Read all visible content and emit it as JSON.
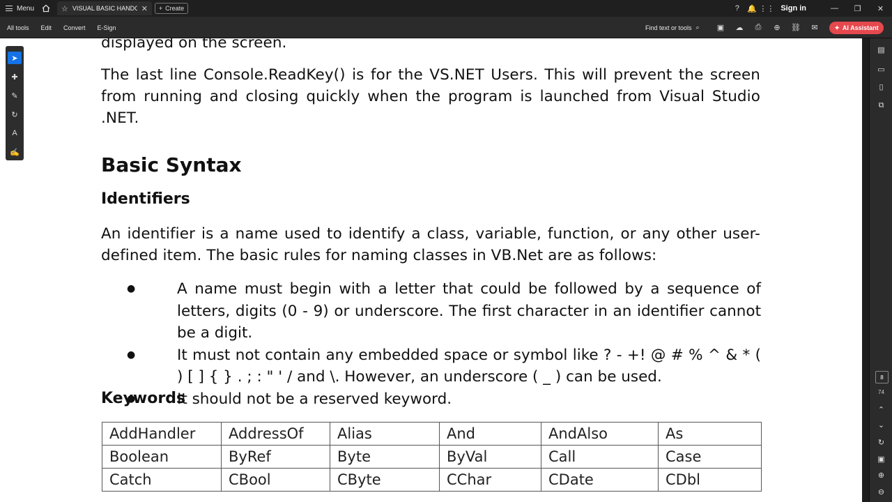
{
  "titlebar": {
    "menu_label": "Menu",
    "tab_title": "VISUAL BASIC HANDOU...",
    "create_label": "Create",
    "signin_label": "Sign in"
  },
  "toolbar": {
    "tools": [
      "All tools",
      "Edit",
      "Convert",
      "E-Sign"
    ],
    "find_label": "Find text or tools",
    "ai_label": "AI Assistant"
  },
  "document": {
    "line_top": "displayed on the screen.",
    "para1": "The last line Console.ReadKey() is for the VS.NET Users. This will prevent the screen from running and closing quickly when the program is launched from Visual Studio .NET.",
    "heading_basic_syntax": "Basic Syntax",
    "heading_identifiers": "Identifiers",
    "para2": "An identifier is a name used to identify a class, variable, function, or any other user-defined item. The basic rules for naming classes in VB.Net are as follows:",
    "bullets": [
      "A name must begin with a letter that could be followed by a sequence of letters, digits (0 - 9) or underscore. The first character in an identifier cannot be a digit.",
      "It must not contain any embedded space or symbol like ? - +! @ # % ^ & * ( ) [ ] { } . ; : \" ' / and \\. However, an underscore ( _ ) can be used.",
      "It should not be a reserved keyword."
    ],
    "heading_keywords": "Keywords",
    "keywords_table": [
      [
        "AddHandler",
        "AddressOf",
        "Alias",
        "And",
        "AndAlso",
        "As"
      ],
      [
        "Boolean",
        "ByRef",
        "Byte",
        "ByVal",
        "Call",
        "Case"
      ],
      [
        "Catch",
        "CBool",
        "CByte",
        "CChar",
        "CDate",
        "CDbl"
      ]
    ]
  },
  "rail": {
    "current_page": "8",
    "total_pages": "74"
  }
}
